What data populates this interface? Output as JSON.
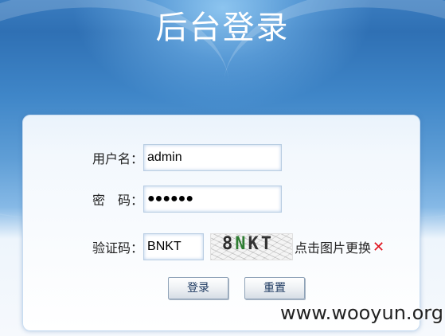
{
  "header": {
    "title": "后台登录"
  },
  "form": {
    "username_label": "用户名：",
    "username_value": "admin",
    "password_label": "密　码：",
    "password_value": "●●●●●●",
    "captcha_label": "验证码：",
    "captcha_value": "BNKT",
    "captcha_image_text": [
      "8",
      "N",
      "K",
      "T"
    ],
    "captcha_refresh_text": "点击图片更换",
    "captcha_close_symbol": "✕",
    "close_color": "#e0141e"
  },
  "buttons": {
    "login_label": "登录",
    "reset_label": "重置"
  },
  "watermark": {
    "text": "www.wooyun.org"
  },
  "colors": {
    "background_top": "#2f70b4",
    "button_text": "#1f3b62"
  }
}
